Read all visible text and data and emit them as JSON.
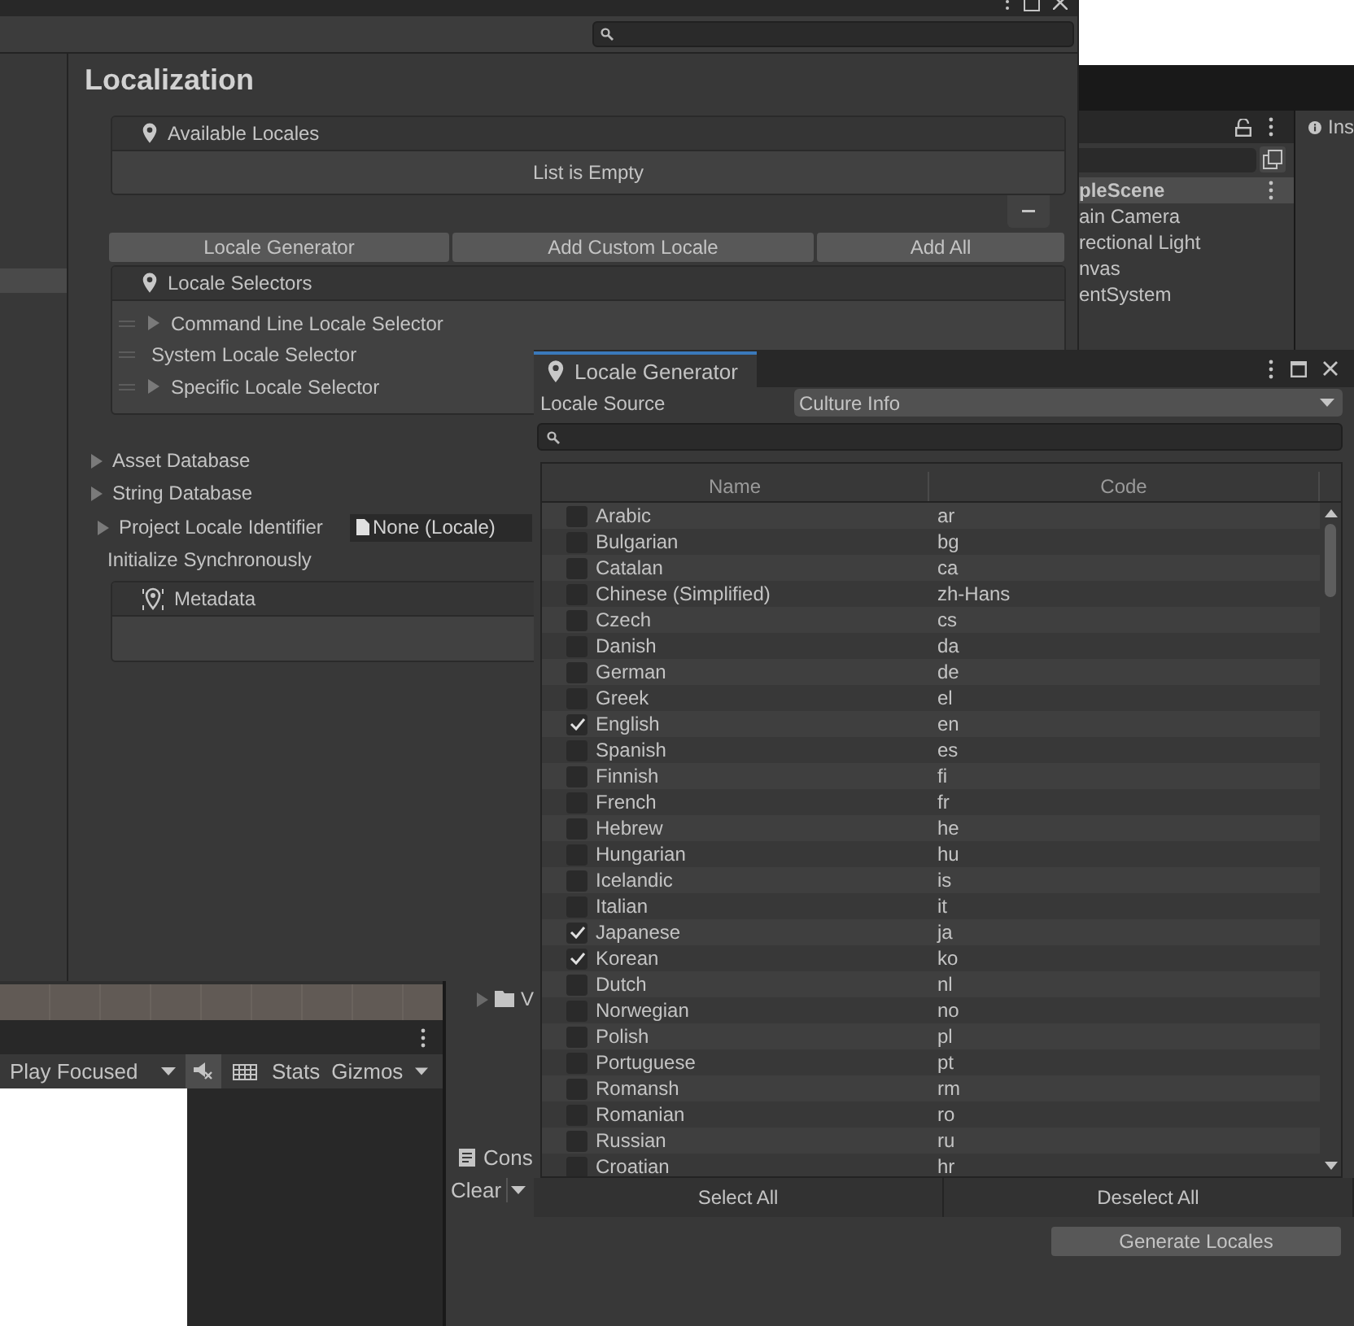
{
  "settings_window": {
    "title": "Localization",
    "available_locales": {
      "header": "Available Locales",
      "empty_text": "List is Empty"
    },
    "buttons": [
      "Locale Generator",
      "Add Custom Locale",
      "Add All"
    ],
    "locale_selectors": {
      "header": "Locale Selectors",
      "items": [
        {
          "label": "Command Line Locale Selector",
          "expandable": true
        },
        {
          "label": "System Locale Selector",
          "expandable": false
        },
        {
          "label": "Specific Locale Selector",
          "expandable": true
        }
      ]
    },
    "foldouts": [
      "Asset Database",
      "String Database"
    ],
    "project_locale_identifier": {
      "label": "Project Locale Identifier",
      "value": "None (Locale)"
    },
    "initialize_synchronously": {
      "label": "Initialize Synchronously"
    },
    "metadata": {
      "header": "Metadata"
    }
  },
  "hierarchy": {
    "items": [
      {
        "label": "pleScene",
        "selected": true
      },
      {
        "label": "ain Camera",
        "selected": false
      },
      {
        "label": "rectional Light",
        "selected": false
      },
      {
        "label": "nvas",
        "selected": false
      },
      {
        "label": "entSystem",
        "selected": false
      }
    ]
  },
  "inspector_tab": {
    "label": "Ins"
  },
  "game_toolbar": {
    "play_mode": "Play Focused",
    "audio_muted": true,
    "stats": "Stats",
    "gizmos": "Gizmos"
  },
  "project": {
    "folder": "V"
  },
  "console": {
    "tab": "Cons",
    "clear_button": "Clear"
  },
  "locale_generator": {
    "title": "Locale Generator",
    "source_label": "Locale Source",
    "source_value": "Culture Info",
    "columns": [
      "Name",
      "Code"
    ],
    "locales": [
      {
        "name": "Arabic",
        "code": "ar",
        "checked": false
      },
      {
        "name": "Bulgarian",
        "code": "bg",
        "checked": false
      },
      {
        "name": "Catalan",
        "code": "ca",
        "checked": false
      },
      {
        "name": "Chinese (Simplified)",
        "code": "zh-Hans",
        "checked": false
      },
      {
        "name": "Czech",
        "code": "cs",
        "checked": false
      },
      {
        "name": "Danish",
        "code": "da",
        "checked": false
      },
      {
        "name": "German",
        "code": "de",
        "checked": false
      },
      {
        "name": "Greek",
        "code": "el",
        "checked": false
      },
      {
        "name": "English",
        "code": "en",
        "checked": true
      },
      {
        "name": "Spanish",
        "code": "es",
        "checked": false
      },
      {
        "name": "Finnish",
        "code": "fi",
        "checked": false
      },
      {
        "name": "French",
        "code": "fr",
        "checked": false
      },
      {
        "name": "Hebrew",
        "code": "he",
        "checked": false
      },
      {
        "name": "Hungarian",
        "code": "hu",
        "checked": false
      },
      {
        "name": "Icelandic",
        "code": "is",
        "checked": false
      },
      {
        "name": "Italian",
        "code": "it",
        "checked": false
      },
      {
        "name": "Japanese",
        "code": "ja",
        "checked": true
      },
      {
        "name": "Korean",
        "code": "ko",
        "checked": true
      },
      {
        "name": "Dutch",
        "code": "nl",
        "checked": false
      },
      {
        "name": "Norwegian",
        "code": "no",
        "checked": false
      },
      {
        "name": "Polish",
        "code": "pl",
        "checked": false
      },
      {
        "name": "Portuguese",
        "code": "pt",
        "checked": false
      },
      {
        "name": "Romansh",
        "code": "rm",
        "checked": false
      },
      {
        "name": "Romanian",
        "code": "ro",
        "checked": false
      },
      {
        "name": "Russian",
        "code": "ru",
        "checked": false
      },
      {
        "name": "Croatian",
        "code": "hr",
        "checked": false
      }
    ],
    "select_all": "Select All",
    "deselect_all": "Deselect All",
    "generate": "Generate Locales"
  }
}
